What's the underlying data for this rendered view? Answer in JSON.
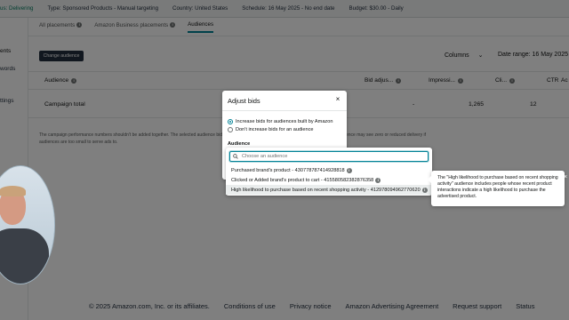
{
  "topbar": {
    "status": "us: Delivering",
    "type": "Type: Sponsored Products - Manual targeting",
    "country": "Country: United States",
    "schedule": "Schedule: 16 May 2025 - No end date",
    "budget": "Budget: $30.00 - Daily"
  },
  "leftnav": {
    "items": [
      "ents",
      "words",
      "ttings"
    ]
  },
  "tabs": [
    {
      "label": "All placements"
    },
    {
      "label": "Amazon Business placements"
    },
    {
      "label": "Audiences"
    }
  ],
  "toolbar": {
    "change_audience": "Change audience",
    "columns": "Columns",
    "date_range": "Date range: 16 May 2025"
  },
  "table": {
    "headers": [
      "Audience",
      "Bid adjus...",
      "Impressi...",
      "Cli...",
      "CTR",
      "Ac"
    ],
    "row": {
      "name": "Campaign total",
      "bid": "-",
      "impressions": "1,265",
      "clicks": "12"
    }
  },
  "note": "The campaign performance numbers shouldn't be added together. The selected audience bid adjustments may overlap with all other audiences shown. Audience may see zero or reduced delivery if audiences are too small to serve ads to.",
  "footer": [
    "© 2025 Amazon.com, Inc. or its affiliates.",
    "Conditions of use",
    "Privacy notice",
    "Amazon Advertising Agreement",
    "Request support",
    "Status"
  ],
  "dialog": {
    "title": "Adjust bids",
    "close": "×",
    "option_increase": "Increase bids for audiences built by Amazon",
    "option_no_increase": "Don't increase bids for an audience",
    "audience_label": "Audience"
  },
  "dropdown": {
    "search_placeholder": "Choose an audience",
    "options": [
      "Purchased brand's product - 430778787414928818",
      "Clicked or Added brand's product to cart - 415580582382876358",
      "High likelihood to purchase based on recent shopping activity - 412978094962770620"
    ]
  },
  "tooltip": {
    "text": "The \"High likelihood to purchase based on recent shopping activity\" audience includes people whose recent product interactions indicate a high likelihood to purchase the advertised product.",
    "close": "×"
  },
  "colors": {
    "accent": "#008296",
    "dark": "#232f3e",
    "status": "#067d62"
  }
}
